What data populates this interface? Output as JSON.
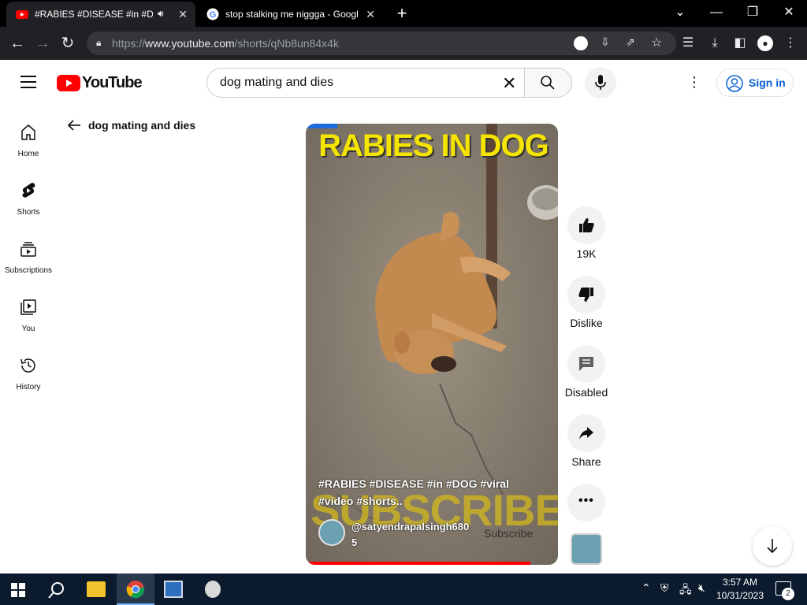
{
  "browser": {
    "tabs": [
      {
        "title": "#RABIES #DISEASE #in #DOG #viral",
        "active": true
      },
      {
        "title": "stop stalking me niggga - Google Search",
        "active": false
      }
    ],
    "new_tab": "+",
    "url_prefix": "https://",
    "url_host": "www.youtube.com",
    "url_path": "/shorts/qNb8un84x4k"
  },
  "youtube": {
    "logo_text": "YouTube",
    "search_value": "dog mating and dies",
    "signin_label": "Sign in",
    "back_label": "dog mating and dies",
    "nav": [
      {
        "label": "Home",
        "icon": "home-icon"
      },
      {
        "label": "Shorts",
        "icon": "shorts-icon"
      },
      {
        "label": "Subscriptions",
        "icon": "subscriptions-icon"
      },
      {
        "label": "You",
        "icon": "you-icon"
      },
      {
        "label": "History",
        "icon": "history-icon"
      }
    ],
    "short": {
      "overlay_title": "RABIES IN DOG",
      "description_line1": "#RABIES #DISEASE #in #DOG #viral",
      "description_line2": "#video #shorts..",
      "watermark": "SUBSCRIBE",
      "channel_line1": "@satyendrapalsingh680",
      "channel_line2": "5",
      "subscribe_label": "Subscribe"
    },
    "actions": {
      "like_count": "19K",
      "dislike_label": "Dislike",
      "comments_label": "Disabled",
      "share_label": "Share"
    }
  },
  "taskbar": {
    "time": "3:57 AM",
    "date": "10/31/2023",
    "notifications": "2"
  },
  "colors": {
    "youtube_red": "#ff0000",
    "link_blue": "#065fd4",
    "chrome_dark": "#202124",
    "taskbar": "#0b1a2c"
  }
}
